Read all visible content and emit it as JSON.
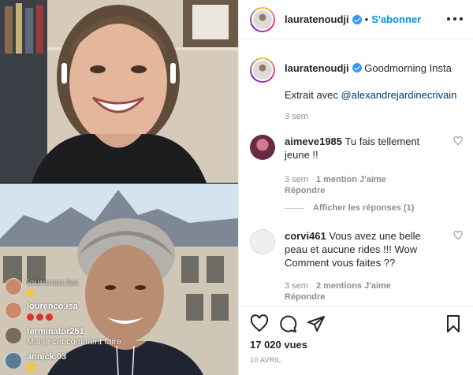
{
  "header": {
    "username": "lauratenoudji",
    "separator": "•",
    "follow_label": "S'abonner"
  },
  "caption": {
    "username": "lauratenoudji",
    "text": "Goodmorning Insta",
    "extract_prefix": "Extrait avec ",
    "mention": "@alexandrejardinecrivain",
    "time": "3 sem"
  },
  "comments": [
    {
      "username": "aimeve1985",
      "text": "Tu fais tellement jeune !!",
      "time": "3 sem",
      "likes": "1 mention J'aime",
      "reply_label": "Répondre",
      "avatar_color": "#b04a6a"
    },
    {
      "username": "corvi461",
      "text": "Vous avez une belle peau et aucune rides !!! Wow Comment vous faites ??",
      "time": "3 sem",
      "likes": "2 mentions J'aime",
      "reply_label": "Répondre",
      "avatar_color": "#dbdbdb"
    }
  ],
  "view_replies_label": "Afficher les réponses (1)",
  "stats": {
    "views": "17 020 vues",
    "date": "10 AVRIL"
  },
  "live_overlay": [
    {
      "username": "lourenco.isa",
      "message": "",
      "faded": true,
      "avatar_color": "#c98a6a"
    },
    {
      "username": "lourenco.isa",
      "message": "",
      "emoji": "face",
      "avatar_color": "#c98a6a"
    },
    {
      "username": "lourenco.isa",
      "message": "",
      "emoji": "dots",
      "avatar_color": "#c98a6a"
    },
    {
      "username": "terminator251",
      "message": "Moi je cet comment faire",
      "avatar_color": "#7a6a5a"
    },
    {
      "username": "annick.03",
      "message": "",
      "emoji": "thumb",
      "avatar_color": "#5a7a9a"
    }
  ],
  "colors": {
    "accent": "#0095f6",
    "verified": "#3897f0",
    "mention": "#00376b",
    "meta": "#8e8e8e"
  },
  "icons": {
    "like": "heart-icon",
    "comment": "comment-bubble-icon",
    "share": "paper-plane-icon",
    "save": "bookmark-icon",
    "more": "more-options-icon",
    "verified": "verified-badge-icon"
  }
}
